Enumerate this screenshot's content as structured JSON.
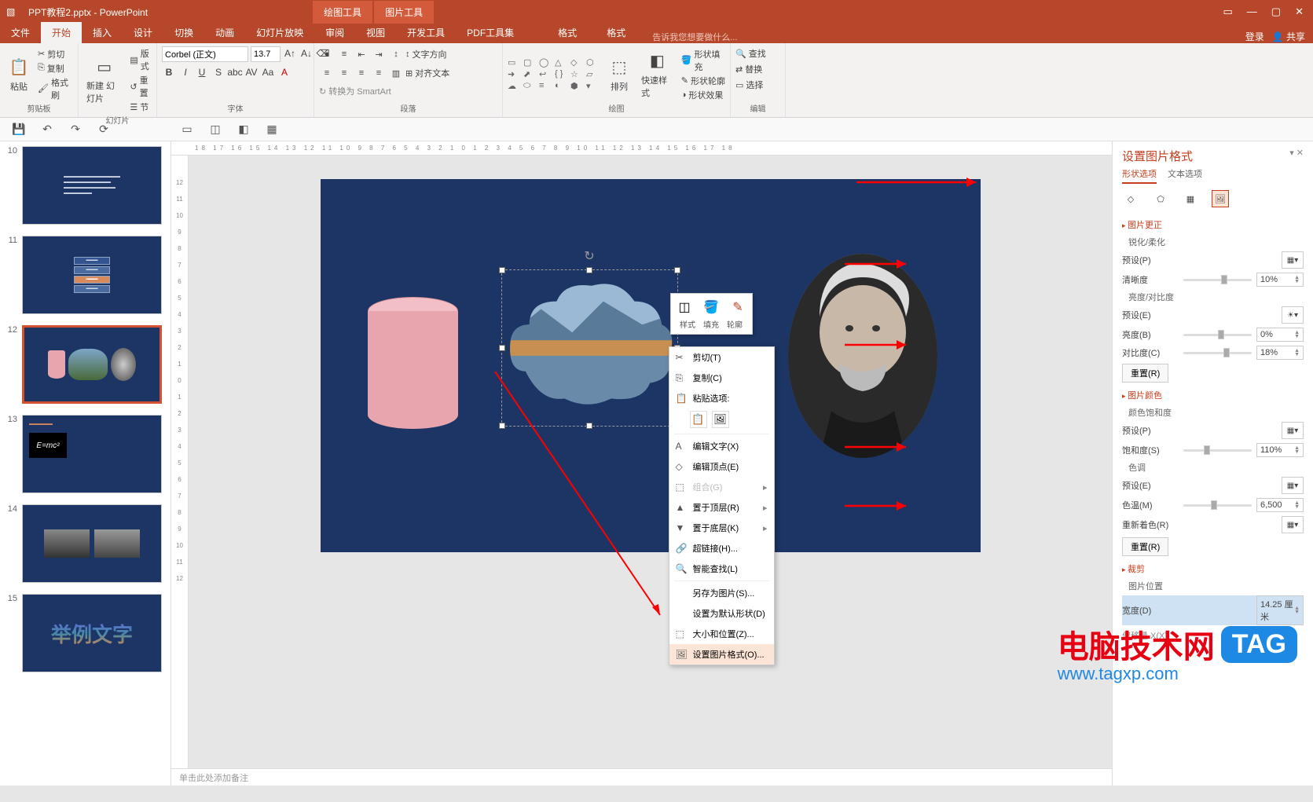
{
  "titlebar": {
    "filename": "PPT教程2.pptx - PowerPoint",
    "tool_tab1": "绘图工具",
    "tool_tab2": "图片工具",
    "login": "登录",
    "share": "共享"
  },
  "tabs": {
    "file": "文件",
    "home": "开始",
    "insert": "插入",
    "design": "设计",
    "transition": "切换",
    "animation": "动画",
    "slideshow": "幻灯片放映",
    "review": "审阅",
    "view": "视图",
    "dev": "开发工具",
    "pdf": "PDF工具集",
    "format1": "格式",
    "format2": "格式",
    "tellme": "告诉我您想要做什么..."
  },
  "ribbon": {
    "clipboard": {
      "label": "剪贴板",
      "paste": "粘贴",
      "cut": "剪切",
      "copy": "复制",
      "format_painter": "格式刷"
    },
    "slides": {
      "label": "幻灯片",
      "new": "新建\n幻灯片",
      "layout": "版式",
      "reset": "重置",
      "section": "节"
    },
    "font": {
      "label": "字体",
      "family": "Corbel (正文)",
      "size": "13.7"
    },
    "paragraph": {
      "label": "段落",
      "text_dir": "文字方向",
      "align_text": "对齐文本",
      "smartart": "转换为 SmartArt"
    },
    "drawing": {
      "label": "绘图",
      "arrange": "排列",
      "quick": "快速样式",
      "fill": "形状填充",
      "outline": "形状轮廓",
      "effects": "形状效果"
    },
    "editing": {
      "label": "编辑",
      "find": "查找",
      "replace": "替换",
      "select": "选择"
    }
  },
  "thumbs": [
    "10",
    "11",
    "12",
    "13",
    "14",
    "15"
  ],
  "ctx_mini": {
    "style": "样式",
    "fill": "填充",
    "outline": "轮廓"
  },
  "ctx": {
    "cut": "剪切(T)",
    "copy": "复制(C)",
    "paste_label": "粘贴选项:",
    "edit_text": "编辑文字(X)",
    "edit_points": "编辑顶点(E)",
    "group": "组合(G)",
    "bring_front": "置于顶层(R)",
    "send_back": "置于底层(K)",
    "hyperlink": "超链接(H)...",
    "smart_lookup": "智能查找(L)",
    "save_pic": "另存为图片(S)...",
    "set_default": "设置为默认形状(D)",
    "size_pos": "大小和位置(Z)...",
    "format_pic": "设置图片格式(O)..."
  },
  "notes": "单击此处添加备注",
  "panel": {
    "title": "设置图片格式",
    "tab_shape": "形状选项",
    "tab_text": "文本选项",
    "sec_correct": "图片更正",
    "sharpen_soft": "锐化/柔化",
    "preset": "预设(P)",
    "sharpness": "清晰度",
    "sharpness_val": "10%",
    "bright_contrast": "亮度/对比度",
    "preset2": "预设(E)",
    "brightness": "亮度(B)",
    "brightness_val": "0%",
    "contrast": "对比度(C)",
    "contrast_val": "18%",
    "reset": "重置(R)",
    "sec_color": "图片颜色",
    "color_sat": "颜色饱和度",
    "preset3": "预设(P)",
    "saturation": "饱和度(S)",
    "saturation_val": "110%",
    "tone": "色调",
    "preset4": "预设(E)",
    "temp": "色温(M)",
    "temp_val": "6,500",
    "recolor": "重新着色(R)",
    "reset2": "重置(R)",
    "sec_crop": "裁剪",
    "pic_pos": "图片位置",
    "width": "宽度(D)",
    "width_val": "14.25 厘米",
    "offset_x": "偏移量 X(X)"
  },
  "watermark": {
    "text": "电脑技术网",
    "tag": "TAG",
    "url": "www.tagxp.com"
  }
}
